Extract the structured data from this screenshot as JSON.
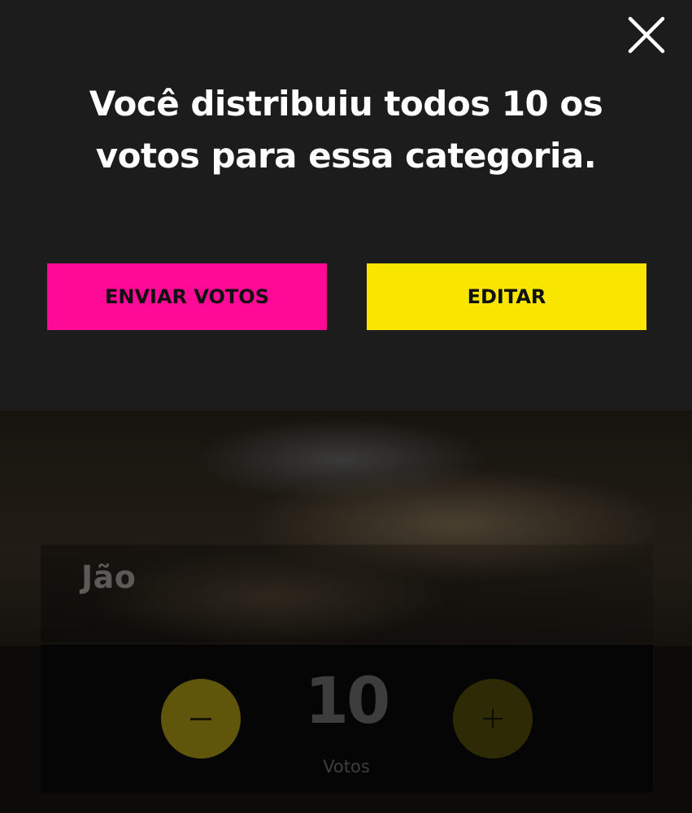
{
  "modal": {
    "message_line1": "Você distribuiu todos 10 os",
    "message_line2": "votos para essa categoria.",
    "send_button_label": "ENVIAR VOTOS",
    "edit_button_label": "EDITAR",
    "close_icon": "close-icon"
  },
  "card": {
    "artist_name": "Jão",
    "vote_count": "10",
    "votes_label": "Votos",
    "decrement_icon": "minus-icon",
    "increment_icon": "plus-icon"
  },
  "colors": {
    "modal_background": "#1c1c1c",
    "send_button": "#ff0a96",
    "edit_button": "#f8e600",
    "text_primary": "#ffffff"
  }
}
